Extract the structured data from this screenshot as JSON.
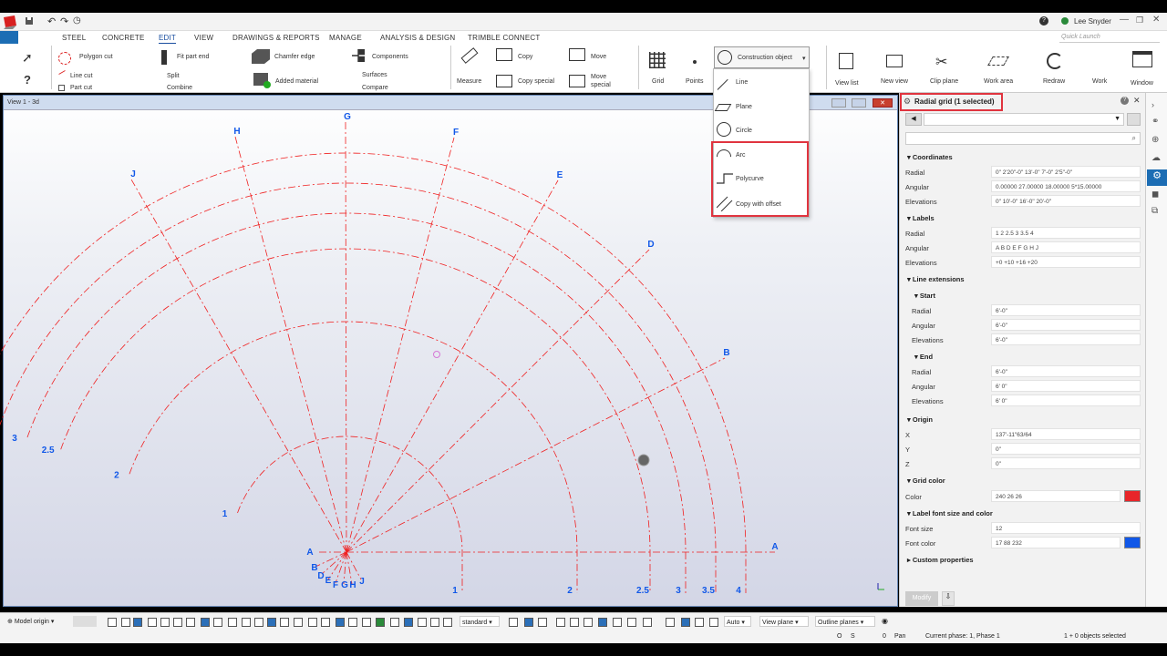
{
  "app": {
    "user": "Lee Snyder",
    "quick_launch_placeholder": "Quick Launch"
  },
  "menu": [
    "STEEL",
    "CONCRETE",
    "EDIT",
    "VIEW",
    "DRAWINGS & REPORTS",
    "MANAGE",
    "ANALYSIS & DESIGN",
    "TRIMBLE CONNECT"
  ],
  "ribbon": {
    "polygon_cut": "Polygon cut",
    "line_cut": "Line cut",
    "part_cut": "Part cut",
    "fit_part_end": "Fit part end",
    "split": "Split",
    "combine": "Combine",
    "chamfer_edge": "Chamfer edge",
    "added_material": "Added material",
    "components": "Components",
    "surfaces": "Surfaces",
    "compare": "Compare",
    "measure": "Measure",
    "copy": "Copy",
    "copy_special": "Copy special",
    "move": "Move",
    "move_special": "Move special",
    "grid": "Grid",
    "points": "Points",
    "construction_object": "Construction object",
    "view_list": "View list",
    "new_view": "New view",
    "clip_plane": "Clip plane",
    "work_area": "Work area",
    "redraw": "Redraw",
    "work": "Work",
    "window": "Window"
  },
  "dropdown": [
    "Line",
    "Plane",
    "Circle",
    "Arc",
    "Polycurve",
    "Copy with offset"
  ],
  "view": {
    "title": "View 1 - 3d"
  },
  "grid": {
    "angular_labels": [
      "A",
      "B",
      "D",
      "E",
      "F",
      "G",
      "H",
      "J"
    ],
    "radial_labels": [
      "1",
      "2",
      "2.5",
      "3",
      "3.5",
      "4"
    ],
    "bottom_labels": [
      "1",
      "2",
      "2.5",
      "3",
      "3.5",
      "4"
    ],
    "origin_labels": [
      "A",
      "B",
      "D",
      "E",
      "F",
      "G",
      "H",
      "J"
    ],
    "line_color": "#f02020",
    "label_color": "#1158e8"
  },
  "panel": {
    "title": "Radial grid (1 selected)",
    "coordinates": "Coordinates",
    "radial_label": "Radial",
    "radial": "0\" 2'20\"-0\" 13'-0\" 7'-0\" 2'5\"-0\"",
    "angular_label": "Angular",
    "angular": "0.00000 27.00000 18.00000 5*15.00000",
    "elevations_label": "Elevations",
    "elevations": "0\" 10'-0\" 16'-0\" 20'-0\"",
    "labels": "Labels",
    "lab_radial": "1 2 2.5 3 3.5 4",
    "lab_angular": "A B D E F G H J",
    "lab_elev": "+0 +10 +16 +20",
    "line_extensions": "Line extensions",
    "start": "Start",
    "end": "End",
    "ext_val": "6'-0\"",
    "ext_val2": "6' 0\"",
    "origin": "Origin",
    "x_label": "X",
    "x": "137'-11\"63/64",
    "y_label": "Y",
    "y": "0\"",
    "z_label": "Z",
    "z": "0\"",
    "grid_color": "Grid color",
    "color_label": "Color",
    "color_val": "240 26 26",
    "color_hex": "#e8262a",
    "label_font": "Label font size and color",
    "font_size_label": "Font size",
    "font_size": "12",
    "font_color_label": "Font color",
    "font_color": "17 88 232",
    "font_color_hex": "#1158e8",
    "custom": "Custom properties",
    "modify": "Modify"
  },
  "bottom": {
    "model_origin": "Model origin",
    "standard": "standard",
    "auto": "Auto",
    "view_plane": "View plane",
    "outline_planes": "Outline planes"
  },
  "status": {
    "o": "O",
    "s": "S",
    "num": "0",
    "pan": "Pan",
    "phase": "Current phase: 1, Phase 1",
    "selected": "1 + 0 objects selected"
  }
}
